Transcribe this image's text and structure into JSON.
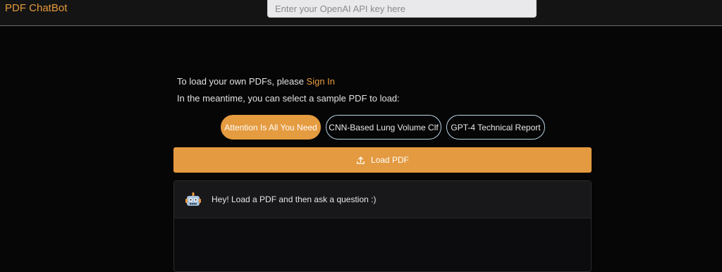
{
  "header": {
    "brand": "PDF ChatBot",
    "api_key_placeholder": "Enter your OpenAI API key here",
    "api_key_value": ""
  },
  "intro": {
    "line1_prefix": "To load your own PDFs, please ",
    "sign_in_link": "Sign In",
    "line2": "In the meantime, you can select a sample PDF to load:"
  },
  "sample_pdfs": [
    {
      "label": "Attention Is All You Need",
      "selected": true
    },
    {
      "label": "CNN-Based Lung Volume Clf",
      "selected": false
    },
    {
      "label": "GPT-4 Technical Report",
      "selected": false
    }
  ],
  "load_button": {
    "label": "Load PDF",
    "icon": "upload-icon"
  },
  "chat": {
    "messages": [
      {
        "sender": "bot",
        "avatar": "robot-icon",
        "text": "Hey! Load a PDF and then ask a question :)"
      }
    ]
  },
  "colors": {
    "accent": "#e59b40",
    "background": "#060606",
    "outline": "#b9d3e4"
  }
}
